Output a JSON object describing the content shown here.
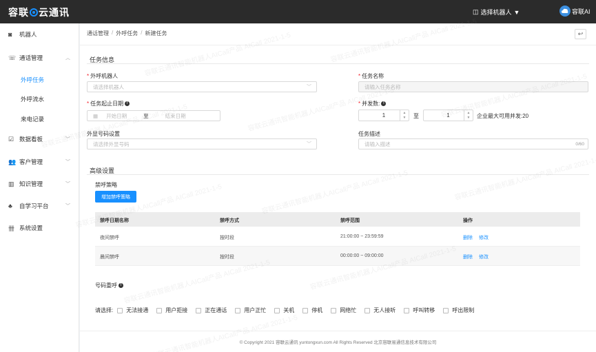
{
  "app": {
    "logo_left": "容联",
    "logo_right": "云通讯"
  },
  "header": {
    "robot_select": "选择机器人",
    "user": "容联AI"
  },
  "sidebar": {
    "items": [
      {
        "label": "机器人",
        "icon": "robot-icon"
      },
      {
        "label": "通话管理",
        "icon": "phone-icon"
      },
      {
        "label": "外呼任务"
      },
      {
        "label": "外呼流水"
      },
      {
        "label": "来电记录"
      },
      {
        "label": "数据看板",
        "icon": "dashboard-icon"
      },
      {
        "label": "客户管理",
        "icon": "users-icon"
      },
      {
        "label": "知识管理",
        "icon": "book-icon"
      },
      {
        "label": "自学习平台",
        "icon": "learn-icon"
      },
      {
        "label": "系统设置",
        "icon": "settings-icon"
      }
    ]
  },
  "breadcrumb": [
    "通话管理",
    "外呼任务",
    "新建任务"
  ],
  "task_info": {
    "title": "任务信息",
    "robot_label": "外呼机器人",
    "robot_placeholder": "请选择机器人",
    "name_label": "任务名称",
    "name_placeholder": "请输入任务名称",
    "date_label": "任务起止日期",
    "start_placeholder": "开始日期",
    "date_to": "至",
    "end_placeholder": "结束日期",
    "concurrency_label": "并发数:",
    "concurrency_min": "1",
    "concurrency_to": "至",
    "concurrency_max": "1",
    "concurrency_note": "企业最大可用并发:20",
    "caller_label": "外显号码设置",
    "caller_placeholder": "请选择外显号码",
    "desc_label": "任务描述",
    "desc_placeholder": "请输入描述",
    "desc_count": "0/60"
  },
  "advanced": {
    "title": "高级设置",
    "block_strategy_label": "禁呼策略",
    "add_button": "增加禁呼策略",
    "table": {
      "headers": [
        "禁呼日期名称",
        "禁呼方式",
        "禁呼范围",
        "操作"
      ],
      "rows": [
        {
          "name": "夜间禁呼",
          "mode": "按时段",
          "range": "21:00:00 ~ 23:59:59",
          "delete": "删除",
          "edit": "修改"
        },
        {
          "name": "晨间禁呼",
          "mode": "按时段",
          "range": "00:00:00 ~ 09:00:00",
          "delete": "删除",
          "edit": "修改"
        }
      ]
    },
    "redial_label": "号码重呼",
    "choose_label": "请选择:",
    "options": [
      "无法接通",
      "用户拒接",
      "正在通话",
      "用户正忙",
      "关机",
      "停机",
      "网络忙",
      "无人接听",
      "呼叫转移",
      "呼出限制"
    ]
  },
  "footer": "© Copyright 2021   容联云通讯   yuntongxun.com   All Rights Reserved  北京容联易通信息技术有限公司",
  "watermark": "容联云通讯智能机器人AICall产品  AICall  2021-1-5"
}
